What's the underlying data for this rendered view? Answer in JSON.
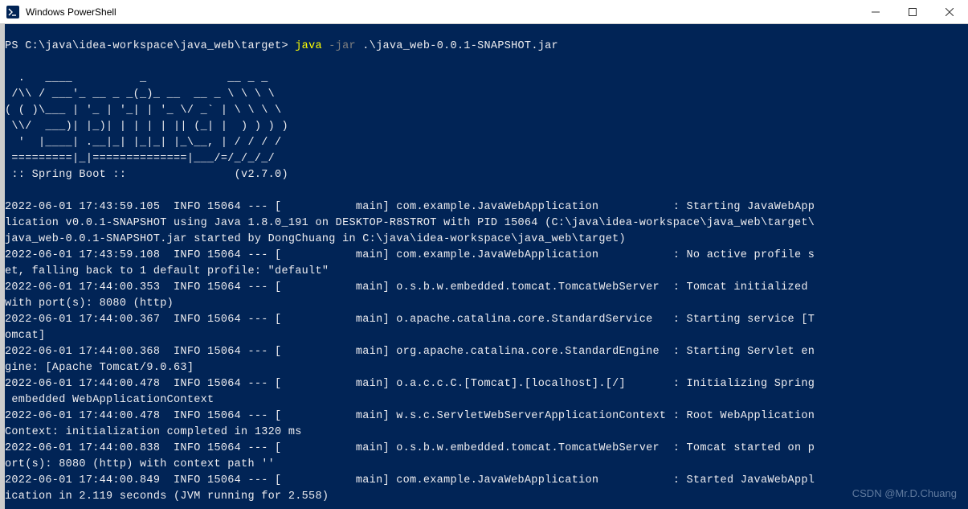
{
  "window": {
    "title": "Windows PowerShell"
  },
  "prompt": {
    "ps": "PS C:\\java\\idea-workspace\\java_web\\target> ",
    "cmd_java": "java",
    "cmd_jar": " -jar",
    "cmd_arg": " .\\java_web-0.0.1-SNAPSHOT.jar"
  },
  "ascii": {
    "l1": "  .   ____          _            __ _ _",
    "l2": " /\\\\ / ___'_ __ _ _(_)_ __  __ _ \\ \\ \\ \\",
    "l3": "( ( )\\___ | '_ | '_| | '_ \\/ _` | \\ \\ \\ \\",
    "l4": " \\\\/  ___)| |_)| | | | | || (_| |  ) ) ) )",
    "l5": "  '  |____| .__|_| |_|_| |_\\__, | / / / /",
    "l6": " =========|_|==============|___/=/_/_/_/",
    "l7": " :: Spring Boot ::                (v2.7.0)"
  },
  "log": {
    "l1": "2022-06-01 17:43:59.105  INFO 15064 --- [           main] com.example.JavaWebApplication           : Starting JavaWebApp",
    "l2": "lication v0.0.1-SNAPSHOT using Java 1.8.0_191 on DESKTOP-R8STROT with PID 15064 (C:\\java\\idea-workspace\\java_web\\target\\",
    "l3": "java_web-0.0.1-SNAPSHOT.jar started by DongChuang in C:\\java\\idea-workspace\\java_web\\target)",
    "l4": "2022-06-01 17:43:59.108  INFO 15064 --- [           main] com.example.JavaWebApplication           : No active profile s",
    "l5": "et, falling back to 1 default profile: \"default\"",
    "l6": "2022-06-01 17:44:00.353  INFO 15064 --- [           main] o.s.b.w.embedded.tomcat.TomcatWebServer  : Tomcat initialized ",
    "l7": "with port(s): 8080 (http)",
    "l8": "2022-06-01 17:44:00.367  INFO 15064 --- [           main] o.apache.catalina.core.StandardService   : Starting service [T",
    "l9": "omcat]",
    "l10": "2022-06-01 17:44:00.368  INFO 15064 --- [           main] org.apache.catalina.core.StandardEngine  : Starting Servlet en",
    "l11": "gine: [Apache Tomcat/9.0.63]",
    "l12": "2022-06-01 17:44:00.478  INFO 15064 --- [           main] o.a.c.c.C.[Tomcat].[localhost].[/]       : Initializing Spring",
    "l13": " embedded WebApplicationContext",
    "l14": "2022-06-01 17:44:00.478  INFO 15064 --- [           main] w.s.c.ServletWebServerApplicationContext : Root WebApplication",
    "l15": "Context: initialization completed in 1320 ms",
    "l16": "2022-06-01 17:44:00.838  INFO 15064 --- [           main] o.s.b.w.embedded.tomcat.TomcatWebServer  : Tomcat started on p",
    "l17": "ort(s): 8080 (http) with context path ''",
    "l18": "2022-06-01 17:44:00.849  INFO 15064 --- [           main] com.example.JavaWebApplication           : Started JavaWebAppl",
    "l19": "ication in 2.119 seconds (JVM running for 2.558)"
  },
  "watermark": "CSDN @Mr.D.Chuang"
}
